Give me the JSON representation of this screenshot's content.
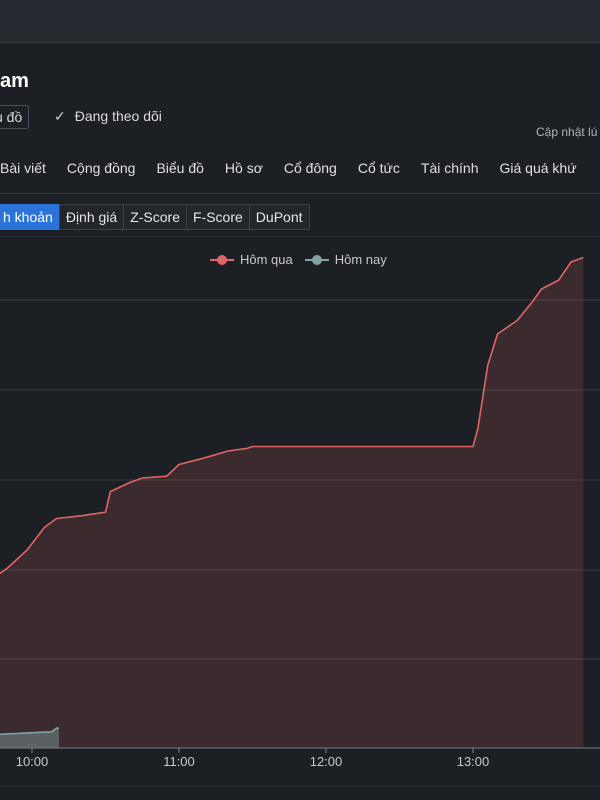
{
  "page": {
    "title": "am",
    "chart_button_label": "u đồ",
    "follow_label": "Đang theo dõi",
    "follow_icon": "check-icon",
    "updated_label": "Cập nhật lú"
  },
  "tabs": [
    "Bài viết",
    "Cộng đồng",
    "Biểu đồ",
    "Hồ sơ",
    "Cổ đông",
    "Cổ tức",
    "Tài chính",
    "Giá quá khứ"
  ],
  "subtabs": [
    {
      "label": "h khoản",
      "active": true
    },
    {
      "label": "Định giá",
      "active": false
    },
    {
      "label": "Z-Score",
      "active": false
    },
    {
      "label": "F-Score",
      "active": false
    },
    {
      "label": "DuPont",
      "active": false
    }
  ],
  "colors": {
    "yesterday": "#e06666",
    "today": "#7fa3a3",
    "active_tab": "#2b73d9"
  },
  "chart_data": {
    "type": "area",
    "legend_position": "top-center",
    "grid": true,
    "x_ticks": [
      "10:00",
      "11:00",
      "12:00",
      "13:00"
    ],
    "series": [
      {
        "name": "Hôm qua",
        "color": "#e06666",
        "points": [
          [
            "09:45",
            1.9
          ],
          [
            "09:50",
            2.0
          ],
          [
            "09:58",
            2.2
          ],
          [
            "10:05",
            2.45
          ],
          [
            "10:10",
            2.55
          ],
          [
            "10:20",
            2.58
          ],
          [
            "10:30",
            2.62
          ],
          [
            "10:32",
            2.85
          ],
          [
            "10:40",
            2.95
          ],
          [
            "10:45",
            3.0
          ],
          [
            "10:55",
            3.02
          ],
          [
            "11:00",
            3.15
          ],
          [
            "11:10",
            3.22
          ],
          [
            "11:20",
            3.3
          ],
          [
            "11:28",
            3.33
          ],
          [
            "11:30",
            3.35
          ],
          [
            "12:00",
            3.35
          ],
          [
            "12:30",
            3.35
          ],
          [
            "13:00",
            3.35
          ],
          [
            "13:02",
            3.55
          ],
          [
            "13:06",
            4.25
          ],
          [
            "13:10",
            4.6
          ],
          [
            "13:18",
            4.75
          ],
          [
            "13:24",
            4.95
          ],
          [
            "13:28",
            5.1
          ],
          [
            "13:35",
            5.2
          ],
          [
            "13:40",
            5.4
          ],
          [
            "13:45",
            5.45
          ]
        ]
      },
      {
        "name": "Hôm nay",
        "color": "#7fa3a3",
        "points": [
          [
            "09:45",
            0.15
          ],
          [
            "10:00",
            0.17
          ],
          [
            "10:08",
            0.18
          ],
          [
            "10:10",
            0.22
          ],
          [
            "10:11",
            0.22
          ]
        ]
      }
    ]
  }
}
